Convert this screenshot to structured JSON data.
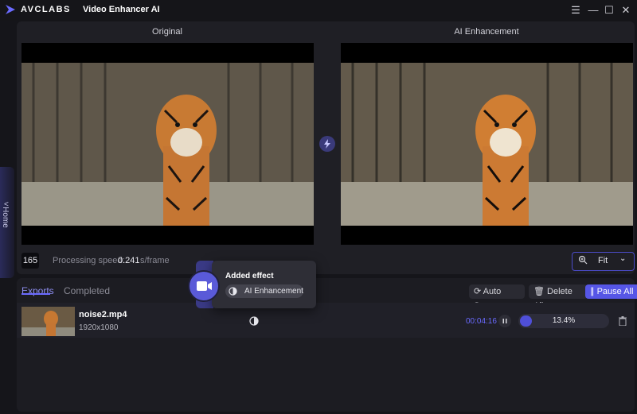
{
  "app": {
    "brand": "AVCLABS",
    "title": "Video Enhancer AI"
  },
  "window_controls": {
    "menu": "☰",
    "minimize": "—",
    "maximize": "☐",
    "close": "✕"
  },
  "sidebar": {
    "home_label": "Home",
    "chevron": "<"
  },
  "preview": {
    "left_label": "Original",
    "right_label": "AI Enhancement",
    "frame_count": "165",
    "speed_label": "Processing speed:",
    "speed_value": "0.241",
    "speed_unit": "s/frame",
    "zoom_value": "Fit",
    "zoom_chevron": "⌄"
  },
  "exports": {
    "tabs": [
      {
        "label": "Exports",
        "active": true
      },
      {
        "label": "Completed",
        "active": false
      }
    ],
    "toolbar": {
      "auto_save": "Auto Save",
      "delete_all": "Delete All",
      "pause_all": "Pause All"
    },
    "rows": [
      {
        "file_name": "noise2.mp4",
        "resolution": "1920x1080",
        "elapsed": "00:04:16",
        "progress_text": "13.4%",
        "progress": 0.134
      }
    ]
  },
  "popup": {
    "title": "Added effect",
    "chip_label": "AI Enhancement"
  },
  "colors": {
    "accent": "#5656e6",
    "accent_text": "#6a6aff",
    "panel": "#1f1f25",
    "background": "#15151a"
  },
  "icons": [
    "logo-icon",
    "menu-icon",
    "minimize-icon",
    "maximize-icon",
    "close-icon",
    "swap-icon",
    "zoom-icon",
    "auto-save-icon",
    "trash-icon",
    "pause-icon",
    "contrast-icon",
    "video-effect-icon"
  ]
}
